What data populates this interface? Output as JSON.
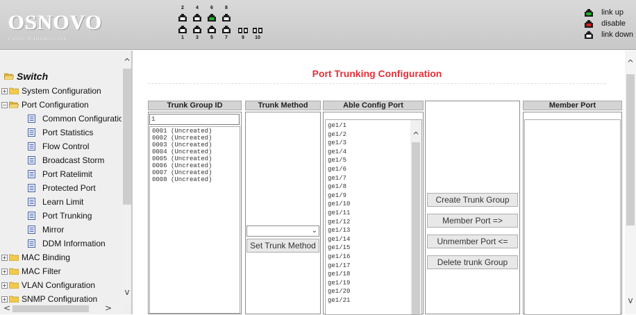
{
  "header": {
    "logo_title": "OSNOVO",
    "logo_subtitle": "cable transmission",
    "port_numbers_top": [
      "2",
      "4",
      "6",
      "8"
    ],
    "port_numbers_bottom": [
      "1",
      "3",
      "5",
      "7"
    ],
    "port_numbers_fiber": [
      "9",
      "10"
    ],
    "colors": {
      "link_up": "#1fb52b",
      "disable": "#d42020",
      "link_down": "#1a1a1a"
    },
    "legend": {
      "link_up": "link up",
      "disable": "disable",
      "link_down": "link down"
    }
  },
  "sidebar": {
    "root": "Switch",
    "items": [
      {
        "label": "System Configuration",
        "type": "folder",
        "expanded": false
      },
      {
        "label": "Port Configuration",
        "type": "folder",
        "expanded": true
      },
      {
        "label": "Common Configuratio",
        "type": "page"
      },
      {
        "label": "Port Statistics",
        "type": "page"
      },
      {
        "label": "Flow Control",
        "type": "page"
      },
      {
        "label": "Broadcast Storm",
        "type": "page"
      },
      {
        "label": "Port Ratelimit",
        "type": "page"
      },
      {
        "label": "Protected Port",
        "type": "page"
      },
      {
        "label": "Learn Limit",
        "type": "page"
      },
      {
        "label": "Port Trunking",
        "type": "page"
      },
      {
        "label": "Mirror",
        "type": "page"
      },
      {
        "label": "DDM Information",
        "type": "page"
      },
      {
        "label": "MAC Binding",
        "type": "folder",
        "expanded": false
      },
      {
        "label": "MAC Filter",
        "type": "folder",
        "expanded": false
      },
      {
        "label": "VLAN Configuration",
        "type": "folder",
        "expanded": false
      },
      {
        "label": "SNMP Configuration",
        "type": "folder",
        "expanded": false
      }
    ]
  },
  "main": {
    "title": "Port Trunking Configuration",
    "columns": {
      "trunk_group_id": "Trunk Group ID",
      "trunk_method": "Trunk Method",
      "able_config_port": "Able Config Port",
      "member_port": "Member Port"
    },
    "trunk_group_input_value": "1",
    "trunk_groups": [
      "0001 (Uncreated)",
      "0002 (Uncreated)",
      "0003 (Uncreated)",
      "0004 (Uncreated)",
      "0005 (Uncreated)",
      "0006 (Uncreated)",
      "0007 (Uncreated)",
      "0008 (Uncreated)"
    ],
    "trunk_method_selected": "",
    "buttons": {
      "set_trunk_method": "Set Trunk Method",
      "create_trunk_group": "Create Trunk Group",
      "member_port": "Member Port =>",
      "unmember_port": "Unmember Port <=",
      "delete_trunk_group": "Delete trunk Group"
    },
    "able_ports": [
      "ge1/1",
      "ge1/2",
      "ge1/3",
      "ge1/4",
      "ge1/5",
      "ge1/6",
      "ge1/7",
      "ge1/8",
      "ge1/9",
      "ge1/10",
      "ge1/11",
      "ge1/12",
      "ge1/13",
      "ge1/14",
      "ge1/15",
      "ge1/16",
      "ge1/17",
      "ge1/18",
      "ge1/19",
      "ge1/20",
      "ge1/21"
    ]
  }
}
